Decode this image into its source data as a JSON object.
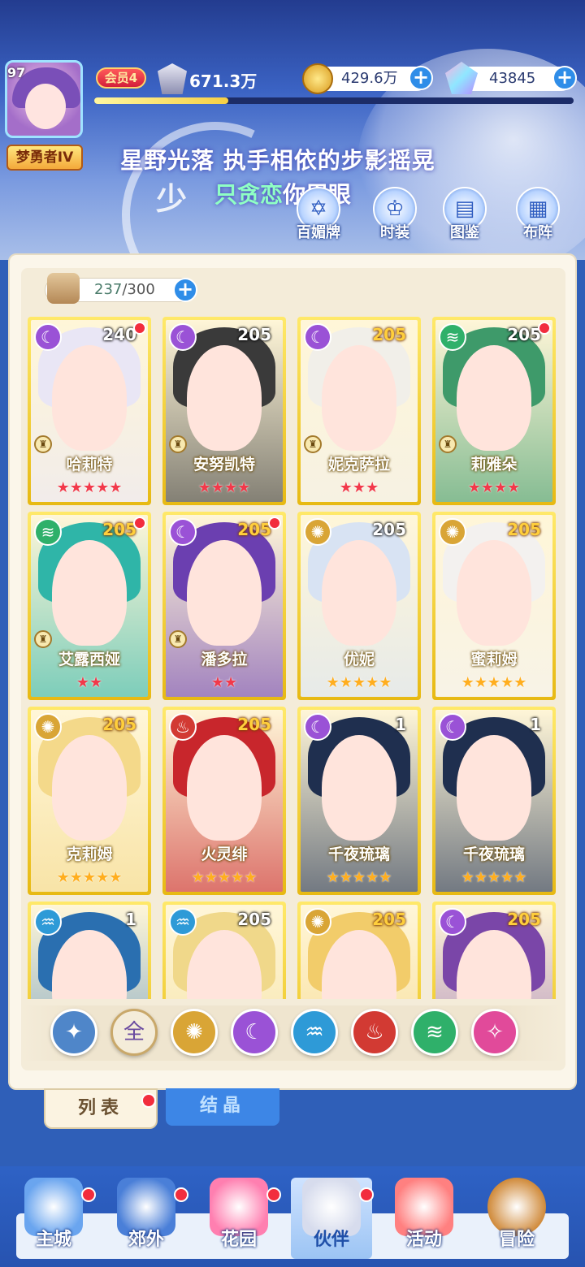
{
  "player": {
    "level": "97",
    "title": "梦勇者IV",
    "vip": "会员4",
    "power": "671.3万",
    "exp_fraction": 0.28
  },
  "resources": {
    "gold": "429.6万",
    "gems": "43845"
  },
  "slogan": {
    "big_char": "少",
    "line1": "星野光落 执手相依的步影摇晃",
    "line2_hl": "只贪恋",
    "line2_rest": "你眉眼"
  },
  "menu": [
    {
      "label": "百媚牌",
      "icon": "badge-icon"
    },
    {
      "label": "时装",
      "icon": "outfit-icon"
    },
    {
      "label": "图鉴",
      "icon": "book-icon"
    },
    {
      "label": "布阵",
      "icon": "grid-icon"
    }
  ],
  "capacity": {
    "current": "237",
    "total": "/300"
  },
  "cards": [
    {
      "name": "哈莉特",
      "level": "240",
      "element": "moon",
      "stars": 5,
      "dot": true,
      "badge": true,
      "hair": "#e9e6f5",
      "lv_gold": false
    },
    {
      "name": "安努凯特",
      "level": "205",
      "element": "moon",
      "stars": 4,
      "dot": false,
      "badge": true,
      "hair": "#3a3a3a",
      "lv_gold": false
    },
    {
      "name": "妮克萨拉",
      "level": "205",
      "element": "moon",
      "stars": 3,
      "dot": false,
      "badge": true,
      "hair": "#f1efe9",
      "lv_gold": true
    },
    {
      "name": "莉雅朵",
      "level": "205",
      "element": "wind",
      "stars": 4,
      "dot": true,
      "badge": true,
      "hair": "#3e9a6a",
      "lv_gold": false
    },
    {
      "name": "艾露西娅",
      "level": "205",
      "element": "wind",
      "stars": 2,
      "dot": true,
      "badge": true,
      "hair": "#2fb5a8",
      "lv_gold": true
    },
    {
      "name": "潘多拉",
      "level": "205",
      "element": "moon",
      "stars": 2,
      "dot": true,
      "badge": true,
      "hair": "#6b3fb0",
      "lv_gold": true
    },
    {
      "name": "优妮",
      "level": "205",
      "element": "sun",
      "stars": 5,
      "dot": false,
      "badge": false,
      "hair": "#d8e3f3",
      "lv_gold": false
    },
    {
      "name": "蜜莉姆",
      "level": "205",
      "element": "sun",
      "stars": 5,
      "dot": false,
      "badge": false,
      "hair": "#f3f1ef",
      "lv_gold": true
    },
    {
      "name": "克莉姆",
      "level": "205",
      "element": "sun",
      "stars": 5,
      "dot": false,
      "badge": false,
      "hair": "#f4d98a",
      "lv_gold": true
    },
    {
      "name": "火灵绯",
      "level": "205",
      "element": "fire",
      "stars": 5,
      "dot": false,
      "badge": false,
      "hair": "#c8262c",
      "lv_gold": true
    },
    {
      "name": "千夜琉璃",
      "level": "1",
      "element": "moon",
      "stars": 5,
      "dot": false,
      "badge": false,
      "hair": "#1f2f4f",
      "lv_gold": false
    },
    {
      "name": "千夜琉璃",
      "level": "1",
      "element": "moon",
      "stars": 5,
      "dot": false,
      "badge": false,
      "hair": "#1f2f4f",
      "lv_gold": false
    },
    {
      "name": "",
      "level": "1",
      "element": "water",
      "stars": 0,
      "dot": false,
      "badge": false,
      "hair": "#2a6fb0",
      "lv_gold": false
    },
    {
      "name": "",
      "level": "205",
      "element": "water",
      "stars": 0,
      "dot": false,
      "badge": false,
      "hair": "#f0d88a",
      "lv_gold": false
    },
    {
      "name": "",
      "level": "205",
      "element": "sun",
      "stars": 0,
      "dot": false,
      "badge": false,
      "hair": "#f2cc6a",
      "lv_gold": true
    },
    {
      "name": "",
      "level": "205",
      "element": "moon",
      "stars": 0,
      "dot": false,
      "badge": false,
      "hair": "#7a46a8",
      "lv_gold": true
    }
  ],
  "filters": [
    {
      "name": "filter-up",
      "glyph": "✦",
      "color": "#4f86c9"
    },
    {
      "name": "filter-all",
      "glyph": "全",
      "color": "#f4ecd9"
    },
    {
      "name": "filter-sun",
      "glyph": "✺",
      "color": "#d9a536"
    },
    {
      "name": "filter-moon",
      "glyph": "☾",
      "color": "#9a52d6"
    },
    {
      "name": "filter-water",
      "glyph": "♒",
      "color": "#2e9ad7"
    },
    {
      "name": "filter-fire",
      "glyph": "♨",
      "color": "#d23a33"
    },
    {
      "name": "filter-wind",
      "glyph": "≋",
      "color": "#2fb06a"
    },
    {
      "name": "filter-star",
      "glyph": "✧",
      "color": "#e14a9a"
    }
  ],
  "tabs": {
    "list": "列表",
    "crystal": "结晶"
  },
  "nav": [
    {
      "label": "主城",
      "color": "#6aa5ef"
    },
    {
      "label": "郊外",
      "color": "#4a7fd8"
    },
    {
      "label": "花园",
      "color": "#ff7fb0"
    },
    {
      "label": "伙伴",
      "color": "#d7dced"
    },
    {
      "label": "活动",
      "color": "#ff8080"
    },
    {
      "label": "冒险",
      "color": "#d08a3a"
    }
  ],
  "colors": {
    "accent": "#2f8de8",
    "card_gold": "#f3cf2e",
    "reddot": "#f22d3d"
  }
}
